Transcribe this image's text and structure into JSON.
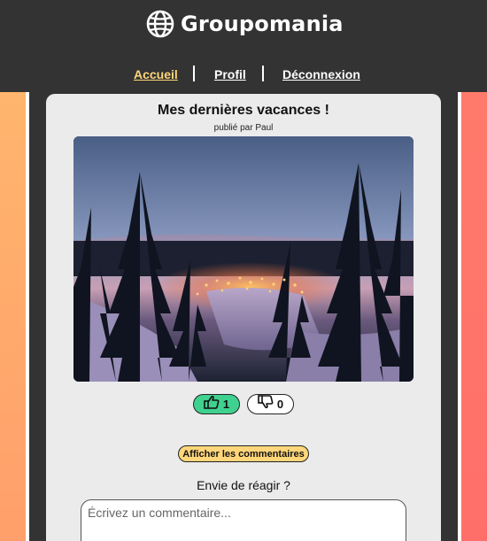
{
  "app": {
    "name": "Groupomania",
    "logo_icon": "globe-icon"
  },
  "nav": {
    "items": [
      {
        "label": "Accueil",
        "active": true
      },
      {
        "label": "Profil",
        "active": false
      },
      {
        "label": "Déconnexion",
        "active": false
      }
    ]
  },
  "post": {
    "title": "Mes dernières vacances !",
    "author_line": "publié par Paul",
    "image_description_icon": "photo-winter-forest",
    "likes": "1",
    "dislikes": "0",
    "like_icon": "thumbs-up-icon",
    "dislike_icon": "thumbs-down-icon",
    "show_comments_label": "Afficher les commentaires",
    "react_label": "Envie de réagir ?",
    "comment_placeholder": "Écrivez un commentaire..."
  },
  "colors": {
    "header_bg": "#333333",
    "active_nav": "#ffd679",
    "like_bg": "#3fd18f",
    "button_yellow": "#ffd679",
    "card_bg": "#ebebeb",
    "side_left": "#ffb56d",
    "side_right": "#ff7a6b"
  }
}
